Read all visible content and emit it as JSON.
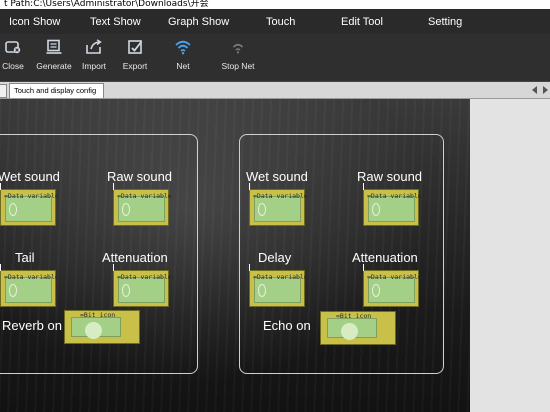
{
  "window": {
    "title": "t Path:C:\\Users\\Administrator\\Downloads\\开会"
  },
  "menu": {
    "icon_show": "Icon Show",
    "text_show": "Text Show",
    "graph_show": "Graph Show",
    "touch": "Touch",
    "edit_tool": "Edit Tool",
    "setting": "Setting"
  },
  "toolbar": {
    "close": {
      "label": "Close",
      "icon": "close-icon"
    },
    "generate": {
      "label": "Generate",
      "icon": "generate-icon"
    },
    "import": {
      "label": "Import",
      "icon": "import-icon"
    },
    "export": {
      "label": "Export",
      "icon": "export-icon"
    },
    "net": {
      "label": "Net",
      "icon": "wifi-icon"
    },
    "stop_net": {
      "label": "Stop Net",
      "icon": "wifi-off-icon"
    }
  },
  "tab": {
    "label": "Touch and display config"
  },
  "canvas": {
    "left": {
      "wet_sound": "Wet sound",
      "raw_sound": "Raw sound",
      "tail": "Tail",
      "attenuation": "Attenuation",
      "toggle_label": "Reverb on"
    },
    "right": {
      "wet_sound": "Wet sound",
      "raw_sound": "Raw sound",
      "delay": "Delay",
      "attenuation": "Attenuation",
      "toggle_label": "Echo on"
    },
    "data_variable_tag": "=Data variable",
    "bit_icon_tag": "=Bit icon"
  },
  "colors": {
    "widget_fill": "#c9c04a",
    "widget_inner": "#a3cf86",
    "menubar": "#2a2a2a",
    "toolbar": "#2f2f2f"
  }
}
